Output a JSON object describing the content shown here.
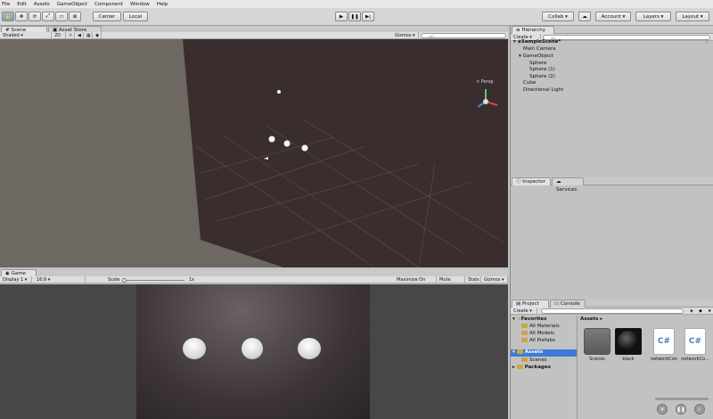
{
  "menu": [
    "File",
    "Edit",
    "Assets",
    "GameObject",
    "Component",
    "Window",
    "Help"
  ],
  "toolbar": {
    "center": "Center",
    "local": "Local",
    "collab": "Collab",
    "account": "Account",
    "layers": "Layers",
    "layout": "Layout"
  },
  "scene_tabs": {
    "scene": "Scene",
    "asset_store": "Asset Store"
  },
  "scene_bar": {
    "shaded": "Shaded",
    "mode": "2D",
    "gizmos": "Gizmos",
    "search": "All"
  },
  "persp_label": "< Persp",
  "game_tab": "Game",
  "game_bar": {
    "display": "Display 1",
    "ratio": "16:9",
    "scale_label": "Scale",
    "scale_value": "1x",
    "maximize": "Maximize On Play",
    "mute": "Mute Audio",
    "stats": "Stats",
    "gizmos": "Gizmos"
  },
  "hierarchy": {
    "tab": "Hierarchy",
    "create": "Create",
    "search": "All",
    "scene": "SampleScene*",
    "items": [
      {
        "label": "Main Camera"
      },
      {
        "label": "GameObject"
      },
      {
        "label": "Sphere"
      },
      {
        "label": "Sphere (1)"
      },
      {
        "label": "Sphere (2)"
      },
      {
        "label": "Cube"
      },
      {
        "label": "Directional Light"
      }
    ]
  },
  "inspector": {
    "tab": "Inspector",
    "services": "Services"
  },
  "project": {
    "tab": "Project",
    "console": "Console",
    "create": "Create",
    "favorites": "Favorites",
    "fav_items": [
      {
        "label": "All Materials"
      },
      {
        "label": "All Models"
      },
      {
        "label": "All Prefabs"
      }
    ],
    "assets": "Assets",
    "scenes": "Scenes",
    "packages": "Packages",
    "breadcrumb": "Assets",
    "grid": [
      {
        "label": "Scenes"
      },
      {
        "label": "black"
      },
      {
        "label": "networkCon"
      },
      {
        "label": "networkCo..."
      }
    ],
    "cs_text": "C#"
  }
}
